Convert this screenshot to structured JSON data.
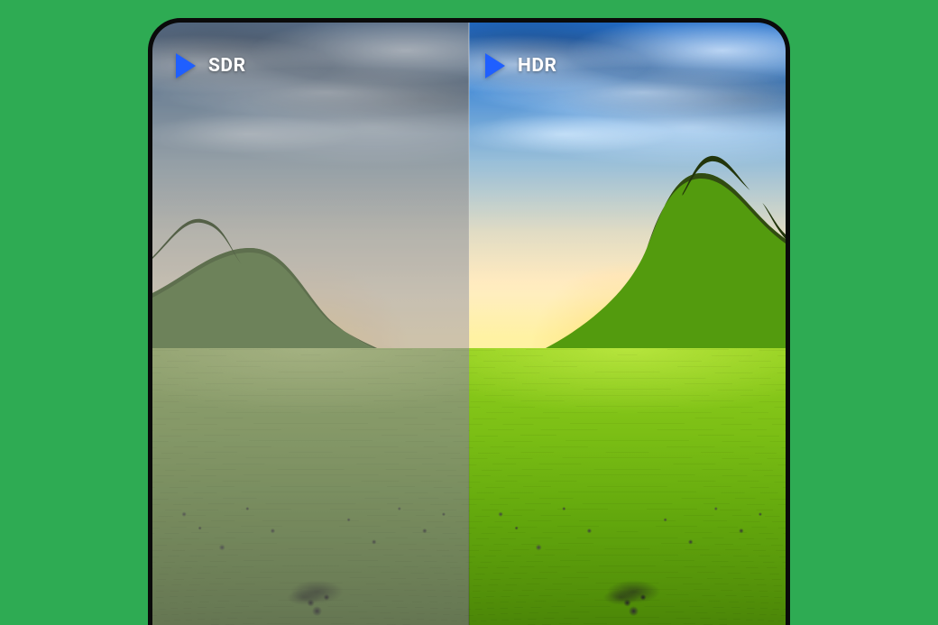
{
  "comparison": {
    "left_label": "SDR",
    "right_label": "HDR",
    "icon": "play-triangle-icon",
    "accent_color": "#1f5fff",
    "background_color": "#2eab53"
  }
}
